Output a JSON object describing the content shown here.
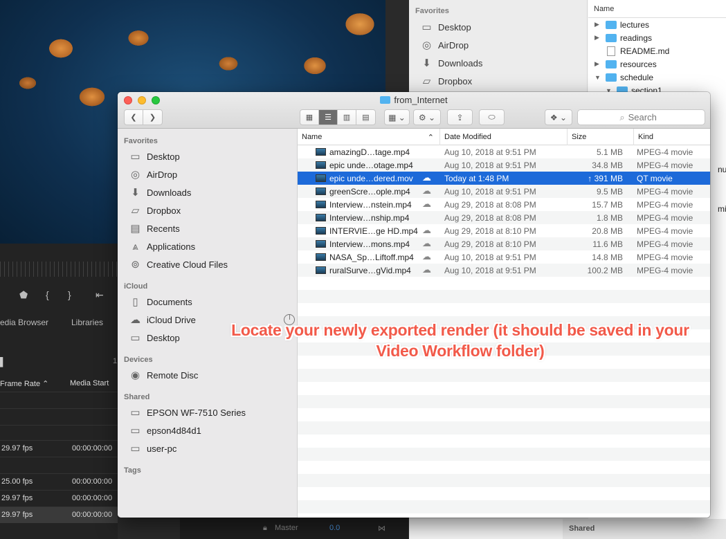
{
  "background_app": {
    "panel_tabs": [
      "edia Browser",
      "Libraries"
    ],
    "columns": [
      "Frame Rate",
      "Media Start"
    ],
    "rows": [
      {
        "rate": "29.97 fps",
        "start": "00:00:00:00"
      },
      {
        "rate": "25.00 fps",
        "start": "00:00:00:00"
      },
      {
        "rate": "29.97 fps",
        "start": "00:00:00:00"
      },
      {
        "rate": "29.97 fps",
        "start": "00:00:00:00"
      }
    ],
    "bottom_label": "Master",
    "bottom_value": "0.0",
    "small_value": "1"
  },
  "background_finder": {
    "favorites_label": "Favorites",
    "sidebar_items": [
      "Desktop",
      "AirDrop",
      "Downloads",
      "Dropbox"
    ],
    "name_header": "Name",
    "tree": [
      {
        "label": "lectures",
        "type": "folder",
        "expandable": true
      },
      {
        "label": "readings",
        "type": "folder",
        "expandable": true
      },
      {
        "label": "README.md",
        "type": "file",
        "expandable": false
      },
      {
        "label": "resources",
        "type": "folder",
        "expandable": true
      },
      {
        "label": "schedule",
        "type": "folder",
        "expandable": true,
        "open": true
      },
      {
        "label": "section1",
        "type": "folder",
        "expandable": true,
        "open": true
      }
    ],
    "fragments": [
      "nued",
      "micL"
    ],
    "shared_label": "Shared"
  },
  "window": {
    "title": "from_Internet",
    "search_placeholder": "Search"
  },
  "sidebar": {
    "favorites_label": "Favorites",
    "favorites": [
      {
        "label": "Desktop",
        "icon": "desktop-icon",
        "glyph": "▭"
      },
      {
        "label": "AirDrop",
        "icon": "airdrop-icon",
        "glyph": "◎"
      },
      {
        "label": "Downloads",
        "icon": "downloads-icon",
        "glyph": "⬇"
      },
      {
        "label": "Dropbox",
        "icon": "folder-icon",
        "glyph": "▱"
      },
      {
        "label": "Recents",
        "icon": "recents-icon",
        "glyph": "▤"
      },
      {
        "label": "Applications",
        "icon": "applications-icon",
        "glyph": "⩓"
      },
      {
        "label": "Creative Cloud Files",
        "icon": "creative-cloud-icon",
        "glyph": "⊚"
      }
    ],
    "icloud_label": "iCloud",
    "icloud": [
      {
        "label": "Documents",
        "icon": "documents-icon",
        "glyph": "▯"
      },
      {
        "label": "iCloud Drive",
        "icon": "cloud-icon",
        "glyph": "☁"
      },
      {
        "label": "Desktop",
        "icon": "desktop-icon",
        "glyph": "▭"
      }
    ],
    "devices_label": "Devices",
    "devices": [
      {
        "label": "Remote Disc",
        "icon": "disc-icon",
        "glyph": "◉"
      }
    ],
    "shared_label": "Shared",
    "shared": [
      {
        "label": "EPSON WF-7510 Series",
        "icon": "computer-icon",
        "glyph": "▭"
      },
      {
        "label": "epson4d84d1",
        "icon": "computer-icon",
        "glyph": "▭"
      },
      {
        "label": "user-pc",
        "icon": "computer-icon",
        "glyph": "▭"
      }
    ],
    "tags_label": "Tags"
  },
  "columns": {
    "name": "Name",
    "date": "Date Modified",
    "size": "Size",
    "kind": "Kind"
  },
  "files": [
    {
      "name": "amazingD…tage.mp4",
      "cloud": false,
      "date": "Aug 10, 2018 at 9:51 PM",
      "size": "5.1 MB",
      "kind": "MPEG-4 movie",
      "selected": false
    },
    {
      "name": "epic unde…otage.mp4",
      "cloud": false,
      "date": "Aug 10, 2018 at 9:51 PM",
      "size": "34.8 MB",
      "kind": "MPEG-4 movie",
      "selected": false
    },
    {
      "name": "epic unde…dered.mov",
      "cloud": true,
      "date": "Today at 1:48 PM",
      "size": "↑ 391 MB",
      "kind": "QT movie",
      "selected": true
    },
    {
      "name": "greenScre…ople.mp4",
      "cloud": true,
      "date": "Aug 10, 2018 at 9:51 PM",
      "size": "9.5 MB",
      "kind": "MPEG-4 movie",
      "selected": false
    },
    {
      "name": "Interview…nstein.mp4",
      "cloud": true,
      "date": "Aug 29, 2018 at 8:08 PM",
      "size": "15.7 MB",
      "kind": "MPEG-4 movie",
      "selected": false
    },
    {
      "name": "Interview…nship.mp4",
      "cloud": false,
      "date": "Aug 29, 2018 at 8:08 PM",
      "size": "1.8 MB",
      "kind": "MPEG-4 movie",
      "selected": false
    },
    {
      "name": "INTERVIE…ge HD.mp4",
      "cloud": true,
      "date": "Aug 29, 2018 at 8:10 PM",
      "size": "20.8 MB",
      "kind": "MPEG-4 movie",
      "selected": false
    },
    {
      "name": "Interview…mons.mp4",
      "cloud": true,
      "date": "Aug 29, 2018 at 8:10 PM",
      "size": "11.6 MB",
      "kind": "MPEG-4 movie",
      "selected": false
    },
    {
      "name": "NASA_Sp…Liftoff.mp4",
      "cloud": true,
      "date": "Aug 10, 2018 at 9:51 PM",
      "size": "14.8 MB",
      "kind": "MPEG-4 movie",
      "selected": false
    },
    {
      "name": "ruralSurve…gVid.mp4",
      "cloud": true,
      "date": "Aug 10, 2018 at 9:51 PM",
      "size": "100.2 MB",
      "kind": "MPEG-4 movie",
      "selected": false
    }
  ],
  "annotation": {
    "line1": "Locate your newly exported render (it should be saved in your",
    "line2": "Video Workflow folder)"
  },
  "colors": {
    "selection": "#1d6ad9",
    "annotation": "#f25a4a",
    "folder": "#52b3f0"
  }
}
